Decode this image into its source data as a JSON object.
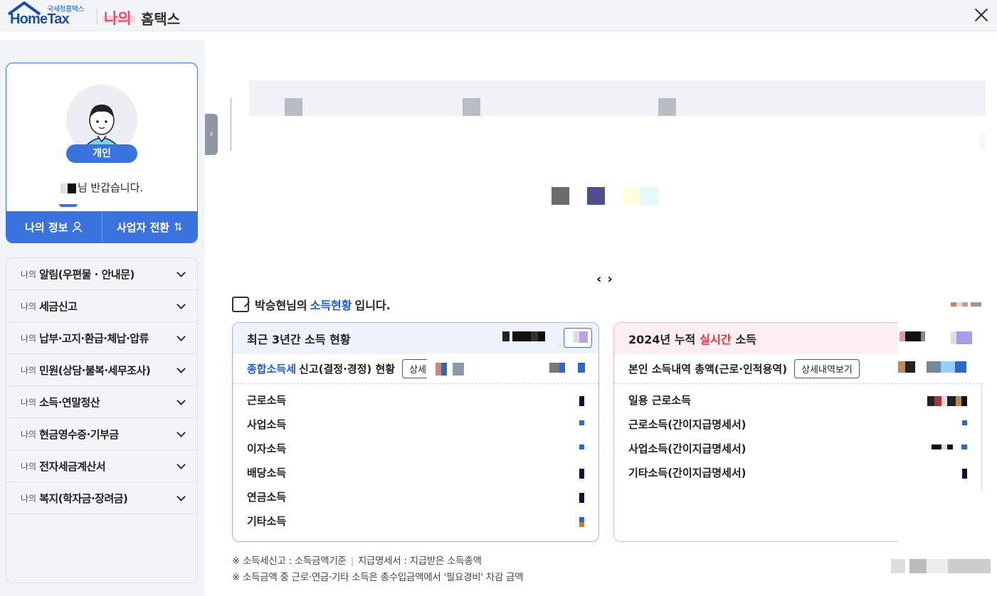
{
  "header": {
    "logo_small": "국세청홈택스",
    "logo_main": "HomeTax",
    "title_highlight": "나의",
    "title_rest": "홈택스"
  },
  "profile": {
    "badge": "개인",
    "greeting": "님 반갑습니다.",
    "my_info_label": "나의 정보",
    "switch_label": "사업자 전환"
  },
  "menu": {
    "prefix": "나의",
    "items": [
      {
        "label": "알림(우편물 · 안내문)"
      },
      {
        "label": "세금신고"
      },
      {
        "label": "납부·고지·환급·체납·압류"
      },
      {
        "label": "민원(상담·불복·세무조사)"
      },
      {
        "label": "소득·연말정산"
      },
      {
        "label": "현금영수증·기부금"
      },
      {
        "label": "전자세금계산서"
      },
      {
        "label": "복지(학자금·장려금)"
      }
    ]
  },
  "income": {
    "title_prefix": "박승현님의",
    "title_highlight": "소득현황",
    "title_suffix": "입니다.",
    "left_box": {
      "title": "최근 3년간 소득 현황",
      "sub_highlight": "종합소득세",
      "sub_rest": "신고(결정·경정) 현황",
      "sub_button": "상세",
      "rows": [
        "근로소득",
        "사업소득",
        "이자소득",
        "배당소득",
        "연금소득",
        "기타소득"
      ]
    },
    "right_box": {
      "title_year": "2024년 누적",
      "title_highlight": "실시간",
      "title_rest": "소득",
      "sub_text": "본인 소득내역 총액(근로·인적용역)",
      "sub_button": "상세내역보기",
      "rows": [
        "일용 근로소득",
        "근로소득(간이지급명세서)",
        "사업소득(간이지급명세서)",
        "기타소득(간이지급명세서)"
      ]
    }
  },
  "footnotes": {
    "line1_a": "※ 소득세신고 : 소득금액기준",
    "line1_b": "지급명세서 : 지급받은 소득총액",
    "line2": "※ 소득금액 중 근로·연금·기타 소득은 총수입금액에서 '필요경비' 차감 금액"
  },
  "colors": {
    "primary_blue": "#3a73de",
    "accent_red": "#e8323a",
    "accent_pink": "#e84d6c"
  }
}
